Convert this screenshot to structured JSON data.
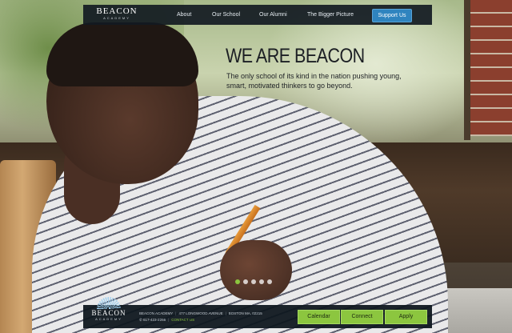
{
  "nav": {
    "logo_name": "BEACON",
    "logo_sub": "ACADEMY",
    "links": [
      "About",
      "Our School",
      "Our Alumni",
      "The Bigger Picture"
    ],
    "cta": "Support Us"
  },
  "hero": {
    "title": "WE ARE BEACON",
    "description": "The only school of its kind in the nation pushing young, smart, motivated thinkers to go beyond.",
    "slides_total": 5,
    "active_slide": 1
  },
  "footer": {
    "logo_name": "BEACON",
    "logo_sub": "ACADEMY",
    "school": "BEACON ACADEMY",
    "address": "477 LONGWOOD AVENUE",
    "city": "BOSTON MA, 02215",
    "phone": "617-423-2266",
    "contact": "CONTACT US",
    "buttons": [
      "Calendar",
      "Connect",
      "Apply"
    ]
  },
  "colors": {
    "accent_green": "#8cc63f",
    "accent_blue": "#2f84bf",
    "bar_dark": "#121a22"
  },
  "icons": [
    "phone-icon"
  ]
}
